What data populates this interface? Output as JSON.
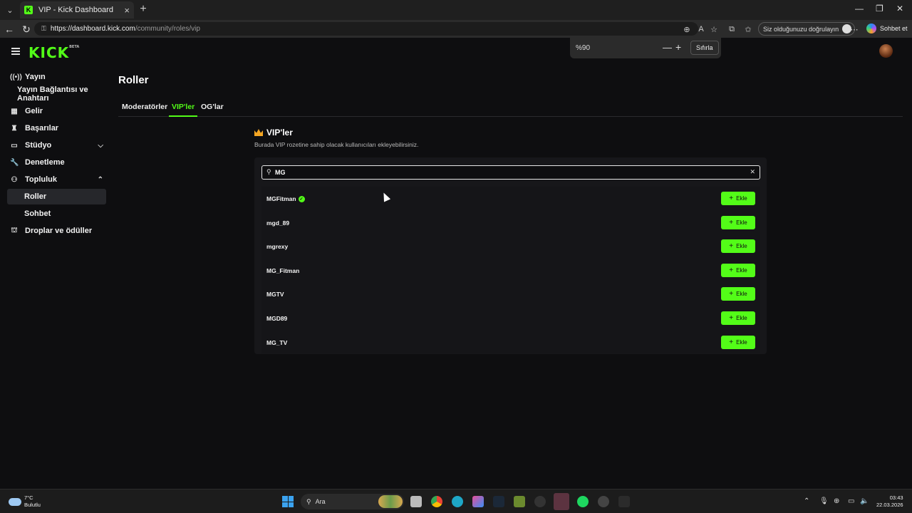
{
  "browser": {
    "tab_title": "VIP - Kick Dashboard",
    "tab_favicon": "K",
    "url_host": "https://dashboard.kick.com",
    "url_path": "/community/roles/vip",
    "verify_label": "Siz olduğunuzu doğrulayın",
    "copilot_label": "Sohbet et",
    "zoom": {
      "value": "%90",
      "reset_label": "Sıfırla"
    }
  },
  "brand": {
    "logo": "KICK",
    "beta": "BETA",
    "accent": "#53fc18"
  },
  "sidebar": {
    "items": [
      {
        "label": "Yayın",
        "icon": "broadcast-icon"
      },
      {
        "label": "Yayın Bağlantısı ve Anahtarı",
        "icon": ""
      },
      {
        "label": "Gelir",
        "icon": "revenue-icon"
      },
      {
        "label": "Başarılar",
        "icon": "trophy-icon"
      },
      {
        "label": "Stüdyo",
        "icon": "studio-icon"
      },
      {
        "label": "Denetleme",
        "icon": "wrench-icon"
      },
      {
        "label": "Topluluk",
        "icon": "community-icon"
      },
      {
        "label": "Roller",
        "icon": ""
      },
      {
        "label": "Sohbet",
        "icon": ""
      },
      {
        "label": "Droplar ve ödüller",
        "icon": "gift-icon"
      }
    ]
  },
  "page": {
    "title": "Roller",
    "tabs": [
      "Moderatörler",
      "VIP'ler",
      "OG'lar"
    ],
    "active_tab": "VIP'ler",
    "section_title": "VIP'ler",
    "section_desc": "Burada VIP rozetine sahip olacak kullanıcıları ekleyebilirsiniz."
  },
  "search": {
    "value": "MG",
    "placeholder": ""
  },
  "results": {
    "add_label": "Ekle",
    "users": [
      {
        "name": "MGFitman",
        "verified": true
      },
      {
        "name": "mgd_89",
        "verified": false
      },
      {
        "name": "mgrexy",
        "verified": false
      },
      {
        "name": "MG_Fitman",
        "verified": false
      },
      {
        "name": "MGTV",
        "verified": false
      },
      {
        "name": "MGD89",
        "verified": false
      },
      {
        "name": "MG_TV",
        "verified": false
      }
    ]
  },
  "taskbar": {
    "weather_temp": "7°C",
    "weather_desc": "Bulutlu",
    "search_label": "Ara",
    "time": "03:43",
    "date": "22.03.2026"
  }
}
